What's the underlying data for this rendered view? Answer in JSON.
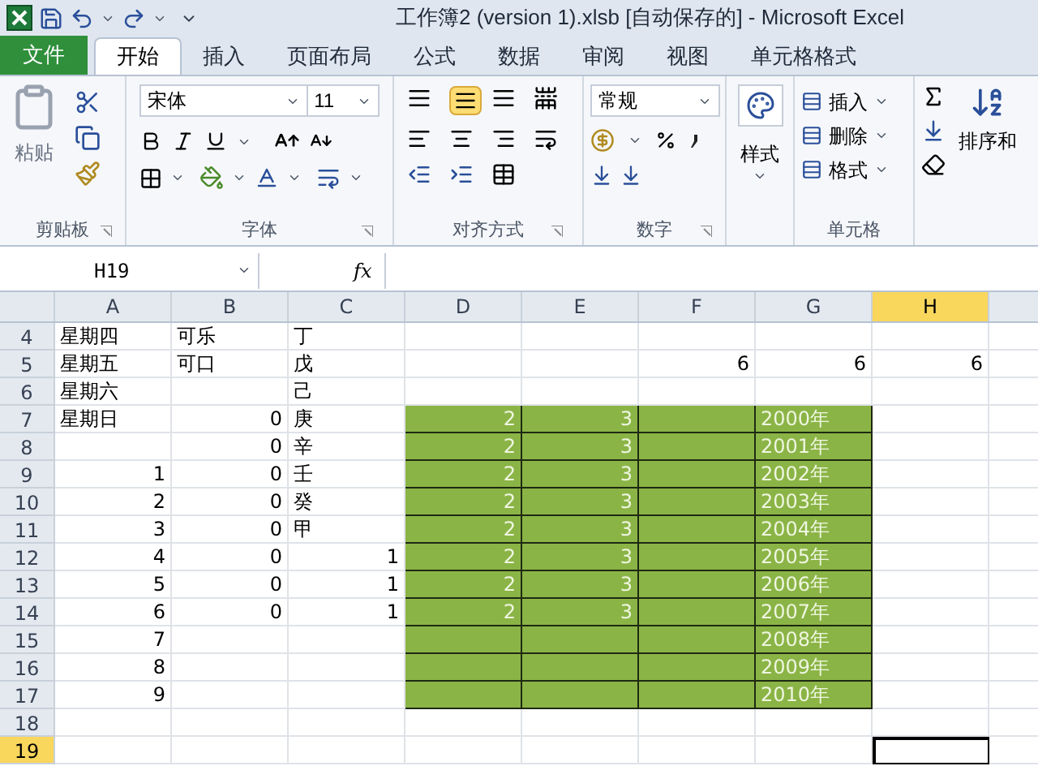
{
  "window": {
    "title": "工作簿2 (version 1).xlsb [自动保存的]  -  Microsoft Excel"
  },
  "tabs": [
    {
      "label": "文件",
      "kind": "file",
      "selected": false
    },
    {
      "label": "开始",
      "kind": "tab",
      "selected": true
    },
    {
      "label": "插入",
      "kind": "tab",
      "selected": false
    },
    {
      "label": "页面布局",
      "kind": "tab",
      "selected": false
    },
    {
      "label": "公式",
      "kind": "tab",
      "selected": false
    },
    {
      "label": "数据",
      "kind": "tab",
      "selected": false
    },
    {
      "label": "审阅",
      "kind": "tab",
      "selected": false
    },
    {
      "label": "视图",
      "kind": "tab",
      "selected": false
    },
    {
      "label": "单元格格式",
      "kind": "tab",
      "selected": false
    }
  ],
  "ribbon": {
    "clipboard": {
      "paste": "粘贴",
      "label": "剪贴板"
    },
    "font": {
      "name": "宋体",
      "size": "11",
      "label": "字体"
    },
    "alignment": {
      "label": "对齐方式",
      "center_selected": true
    },
    "number": {
      "format": "常规",
      "label": "数字"
    },
    "styles": {
      "label": "样式"
    },
    "cells": {
      "items": [
        "插入",
        "删除",
        "格式"
      ],
      "label": "单元格"
    },
    "editing": {
      "sort": "排序和"
    }
  },
  "formula_bar": {
    "name_box": "H19",
    "fx": "fx"
  },
  "sheet": {
    "columns": [
      {
        "label": "A",
        "selected": false
      },
      {
        "label": "B",
        "selected": false
      },
      {
        "label": "C",
        "selected": false
      },
      {
        "label": "D",
        "selected": false
      },
      {
        "label": "E",
        "selected": false
      },
      {
        "label": "F",
        "selected": false
      },
      {
        "label": "G",
        "selected": false
      },
      {
        "label": "H",
        "selected": true
      }
    ],
    "rows": [
      {
        "header": "4",
        "selected": false,
        "cells": [
          {
            "text": "星期四",
            "kind": "text",
            "filled": false
          },
          {
            "text": "可乐",
            "kind": "text",
            "filled": false
          },
          {
            "text": "丁",
            "kind": "text",
            "filled": false
          },
          null,
          null,
          null,
          null,
          null
        ]
      },
      {
        "header": "5",
        "selected": false,
        "cells": [
          {
            "text": "星期五",
            "kind": "text",
            "filled": false
          },
          {
            "text": "可口",
            "kind": "text",
            "filled": false
          },
          {
            "text": "戊",
            "kind": "text",
            "filled": false
          },
          null,
          null,
          {
            "text": "6",
            "kind": "number",
            "filled": false
          },
          {
            "text": "6",
            "kind": "number",
            "filled": false
          },
          {
            "text": "6",
            "kind": "number",
            "filled": false
          }
        ]
      },
      {
        "header": "6",
        "selected": false,
        "cells": [
          {
            "text": "星期六",
            "kind": "text",
            "filled": false
          },
          null,
          {
            "text": "己",
            "kind": "text",
            "filled": false
          },
          null,
          null,
          null,
          null,
          null
        ]
      },
      {
        "header": "7",
        "selected": false,
        "cells": [
          {
            "text": "星期日",
            "kind": "text",
            "filled": false
          },
          {
            "text": "0",
            "kind": "number",
            "filled": false
          },
          {
            "text": "庚",
            "kind": "text",
            "filled": false
          },
          {
            "text": "2",
            "kind": "number",
            "filled": true
          },
          {
            "text": "3",
            "kind": "number",
            "filled": true
          },
          {
            "filled": true
          },
          {
            "text": "2000年",
            "kind": "text",
            "filled": true
          },
          null
        ]
      },
      {
        "header": "8",
        "selected": false,
        "cells": [
          null,
          {
            "text": "0",
            "kind": "number",
            "filled": false
          },
          {
            "text": "辛",
            "kind": "text",
            "filled": false
          },
          {
            "text": "2",
            "kind": "number",
            "filled": true
          },
          {
            "text": "3",
            "kind": "number",
            "filled": true
          },
          {
            "filled": true
          },
          {
            "text": "2001年",
            "kind": "text",
            "filled": true
          },
          null
        ]
      },
      {
        "header": "9",
        "selected": false,
        "cells": [
          {
            "text": "1",
            "kind": "number",
            "filled": false
          },
          {
            "text": "0",
            "kind": "number",
            "filled": false
          },
          {
            "text": "壬",
            "kind": "text",
            "filled": false
          },
          {
            "text": "2",
            "kind": "number",
            "filled": true
          },
          {
            "text": "3",
            "kind": "number",
            "filled": true
          },
          {
            "filled": true
          },
          {
            "text": "2002年",
            "kind": "text",
            "filled": true
          },
          null
        ]
      },
      {
        "header": "10",
        "selected": false,
        "cells": [
          {
            "text": "2",
            "kind": "number",
            "filled": false
          },
          {
            "text": "0",
            "kind": "number",
            "filled": false
          },
          {
            "text": "癸",
            "kind": "text",
            "filled": false
          },
          {
            "text": "2",
            "kind": "number",
            "filled": true
          },
          {
            "text": "3",
            "kind": "number",
            "filled": true
          },
          {
            "filled": true
          },
          {
            "text": "2003年",
            "kind": "text",
            "filled": true
          },
          null
        ]
      },
      {
        "header": "11",
        "selected": false,
        "cells": [
          {
            "text": "3",
            "kind": "number",
            "filled": false
          },
          {
            "text": "0",
            "kind": "number",
            "filled": false
          },
          {
            "text": "甲",
            "kind": "text",
            "filled": false
          },
          {
            "text": "2",
            "kind": "number",
            "filled": true
          },
          {
            "text": "3",
            "kind": "number",
            "filled": true
          },
          {
            "filled": true
          },
          {
            "text": "2004年",
            "kind": "text",
            "filled": true
          },
          null
        ]
      },
      {
        "header": "12",
        "selected": false,
        "cells": [
          {
            "text": "4",
            "kind": "number",
            "filled": false
          },
          {
            "text": "0",
            "kind": "number",
            "filled": false
          },
          {
            "text": "1",
            "kind": "number",
            "filled": false
          },
          {
            "text": "2",
            "kind": "number",
            "filled": true
          },
          {
            "text": "3",
            "kind": "number",
            "filled": true
          },
          {
            "filled": true
          },
          {
            "text": "2005年",
            "kind": "text",
            "filled": true
          },
          null
        ]
      },
      {
        "header": "13",
        "selected": false,
        "cells": [
          {
            "text": "5",
            "kind": "number",
            "filled": false
          },
          {
            "text": "0",
            "kind": "number",
            "filled": false
          },
          {
            "text": "1",
            "kind": "number",
            "filled": false
          },
          {
            "text": "2",
            "kind": "number",
            "filled": true
          },
          {
            "text": "3",
            "kind": "number",
            "filled": true
          },
          {
            "filled": true
          },
          {
            "text": "2006年",
            "kind": "text",
            "filled": true
          },
          null
        ]
      },
      {
        "header": "14",
        "selected": false,
        "cells": [
          {
            "text": "6",
            "kind": "number",
            "filled": false
          },
          {
            "text": "0",
            "kind": "number",
            "filled": false
          },
          {
            "text": "1",
            "kind": "number",
            "filled": false
          },
          {
            "text": "2",
            "kind": "number",
            "filled": true
          },
          {
            "text": "3",
            "kind": "number",
            "filled": true
          },
          {
            "filled": true
          },
          {
            "text": "2007年",
            "kind": "text",
            "filled": true
          },
          null
        ]
      },
      {
        "header": "15",
        "selected": false,
        "cells": [
          {
            "text": "7",
            "kind": "number",
            "filled": false
          },
          null,
          null,
          {
            "filled": true
          },
          {
            "filled": true
          },
          {
            "filled": true
          },
          {
            "text": "2008年",
            "kind": "text",
            "filled": true
          },
          null
        ]
      },
      {
        "header": "16",
        "selected": false,
        "cells": [
          {
            "text": "8",
            "kind": "number",
            "filled": false
          },
          null,
          null,
          {
            "filled": true
          },
          {
            "filled": true
          },
          {
            "filled": true
          },
          {
            "text": "2009年",
            "kind": "text",
            "filled": true
          },
          null
        ]
      },
      {
        "header": "17",
        "selected": false,
        "cells": [
          {
            "text": "9",
            "kind": "number",
            "filled": false
          },
          null,
          null,
          {
            "filled": true
          },
          {
            "filled": true
          },
          {
            "filled": true
          },
          {
            "text": "2010年",
            "kind": "text",
            "filled": true
          },
          null
        ]
      },
      {
        "header": "18",
        "selected": false,
        "cells": [
          null,
          null,
          null,
          null,
          null,
          null,
          null,
          null
        ]
      },
      {
        "header": "19",
        "selected": true,
        "cells": [
          null,
          null,
          null,
          null,
          null,
          null,
          null,
          null
        ]
      }
    ]
  }
}
